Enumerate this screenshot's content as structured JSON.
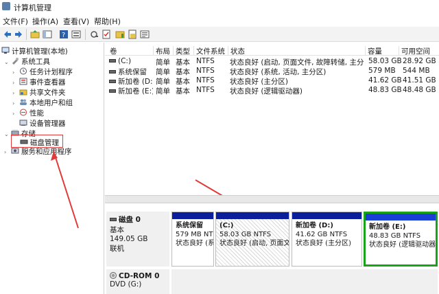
{
  "window": {
    "title": "计算机管理"
  },
  "menu": [
    "文件(F)",
    "操作(A)",
    "查看(V)",
    "帮助(H)"
  ],
  "toolbar": [
    "back-icon",
    "forward-icon",
    "up-icon",
    "show-hide-tree-icon",
    "help-icon",
    "properties-icon",
    "refresh-icon",
    "check-icon",
    "folder-icon",
    "export-icon",
    "list-icon"
  ],
  "tree": {
    "root": "计算机管理(本地)",
    "items": [
      {
        "label": "系统工具"
      },
      {
        "label": "任务计划程序"
      },
      {
        "label": "事件查看器"
      },
      {
        "label": "共享文件夹"
      },
      {
        "label": "本地用户和组"
      },
      {
        "label": "性能"
      },
      {
        "label": "设备管理器"
      },
      {
        "label": "存储"
      },
      {
        "label": "磁盘管理"
      },
      {
        "label": "服务和应用程序"
      }
    ]
  },
  "volumes": {
    "columns": [
      "卷",
      "布局",
      "类型",
      "文件系统",
      "状态",
      "容量",
      "可用空间"
    ],
    "rows": [
      [
        "(C:)",
        "简单",
        "基本",
        "NTFS",
        "状态良好 (启动, 页面文件, 故障转储, 主分区)",
        "58.03 GB",
        "28.92 GB"
      ],
      [
        "系统保留",
        "简单",
        "基本",
        "NTFS",
        "状态良好 (系统, 活动, 主分区)",
        "579 MB",
        "544 MB"
      ],
      [
        "新加卷 (D:)",
        "简单",
        "基本",
        "NTFS",
        "状态良好 (主分区)",
        "41.62 GB",
        "41.51 GB"
      ],
      [
        "新加卷 (E:)",
        "简单",
        "基本",
        "NTFS",
        "状态良好 (逻辑驱动器)",
        "48.83 GB",
        "48.48 GB"
      ]
    ]
  },
  "disks": [
    {
      "name": "磁盘 0",
      "type": "基本",
      "size": "149.05 GB",
      "status": "联机",
      "partitions": [
        {
          "name": "系统保留",
          "size": "579 MB NTF",
          "status": "状态良好 (系"
        },
        {
          "name": "(C:)",
          "size": "58.03 GB NTFS",
          "status": "状态良好 (启动, 页面文"
        },
        {
          "name": "新加卷 (D:)",
          "size": "41.62 GB NTFS",
          "status": "状态良好 (主分区)"
        },
        {
          "name": "新加卷 (E:)",
          "size": "48.83 GB NTFS",
          "status": "状态良好 (逻辑驱动器"
        }
      ]
    },
    {
      "name": "CD-ROM 0",
      "type": "DVD (G:)"
    }
  ],
  "colors": {
    "partition_bar": "#0b1f9c",
    "selected_border": "#19a319",
    "annotation": "#e03a3a"
  }
}
